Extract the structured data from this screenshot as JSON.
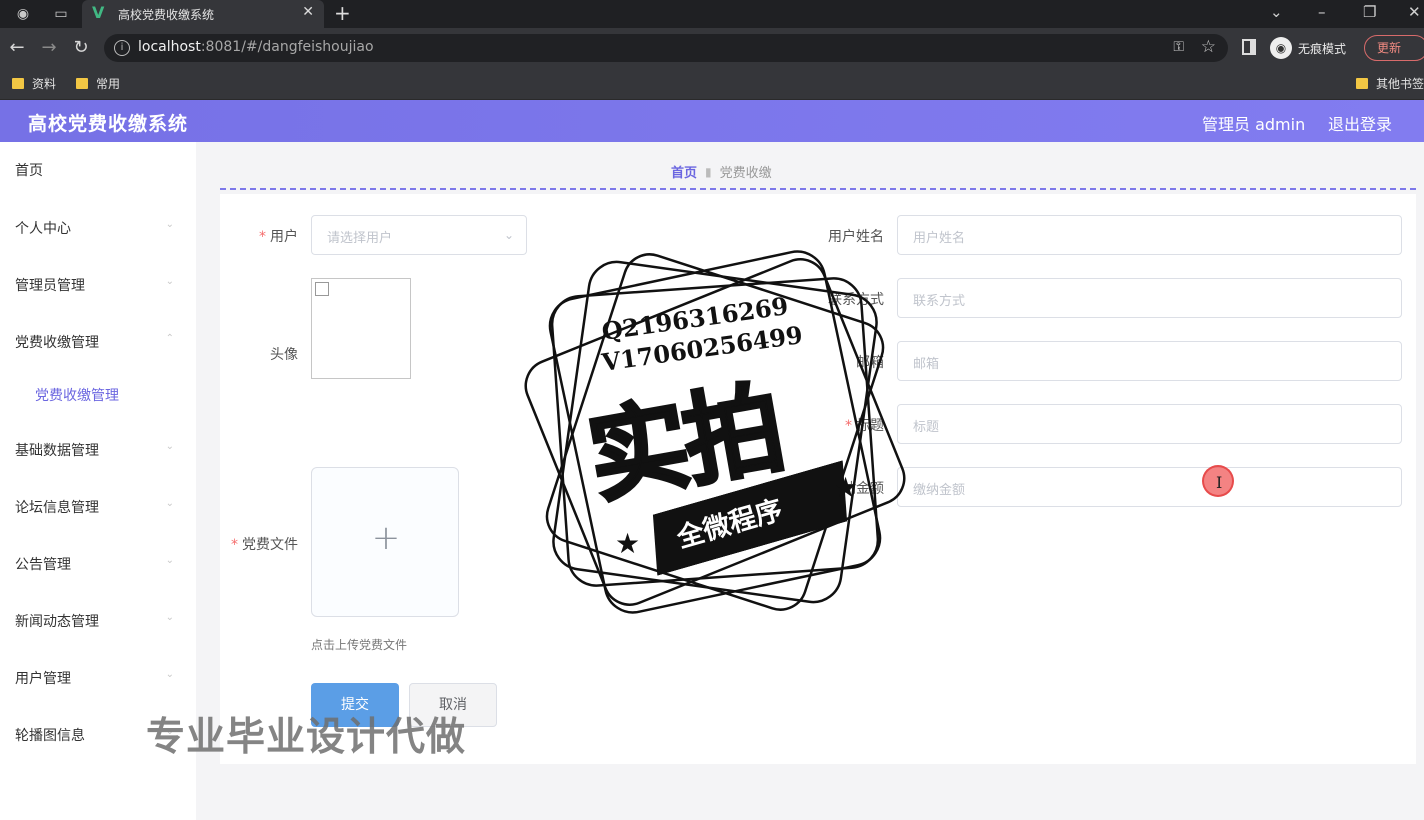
{
  "browser": {
    "tab_title": "高校党费收缴系统",
    "url_host": "localhost",
    "url_path": ":8081/#/dangfeishoujiao",
    "incognito_label": "无痕模式",
    "update_label": "更新",
    "bookmarks": [
      {
        "label": "资料"
      },
      {
        "label": "常用"
      },
      {
        "label": "其他书签"
      }
    ]
  },
  "header": {
    "title": "高校党费收缴系统",
    "user": "管理员 admin",
    "logout": "退出登录"
  },
  "sidebar": {
    "items": [
      {
        "label": "首页"
      },
      {
        "label": "个人中心"
      },
      {
        "label": "管理员管理"
      },
      {
        "label": "党费收缴管理"
      },
      {
        "label": "党费收缴管理"
      },
      {
        "label": "基础数据管理"
      },
      {
        "label": "论坛信息管理"
      },
      {
        "label": "公告管理"
      },
      {
        "label": "新闻动态管理"
      },
      {
        "label": "用户管理"
      },
      {
        "label": "轮播图信息"
      }
    ]
  },
  "breadcrumb": {
    "home": "首页",
    "current": "党费收缴"
  },
  "form": {
    "user_label": "用户",
    "user_placeholder": "请选择用户",
    "avatar_label": "头像",
    "file_label": "党费文件",
    "upload_tip": "点击上传党费文件",
    "name_label": "用户姓名",
    "name_placeholder": "用户姓名",
    "phone_label": "联系方式",
    "phone_placeholder": "联系方式",
    "email_label": "邮箱",
    "email_placeholder": "邮箱",
    "title_label": "标题",
    "title_placeholder": "标题",
    "amount_label": "缴纳金额",
    "amount_placeholder": "缴纳金额",
    "submit": "提交",
    "cancel": "取消"
  },
  "watermark": {
    "line1": "Q2196316269",
    "line2": "V17060256499",
    "main": "实拍",
    "banner": "全微程序",
    "footer": "专业毕业设计代做"
  },
  "colors": {
    "header_bg": "#7b76e8",
    "accent": "#6b66e0",
    "primary_button": "#5b9ee6",
    "required": "#f56c6c"
  }
}
